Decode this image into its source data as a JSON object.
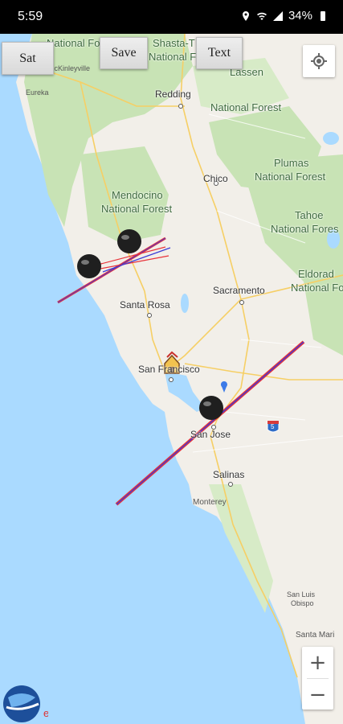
{
  "status_bar": {
    "time": "5:59",
    "battery": "34%"
  },
  "toolbar": {
    "sat_label": "Sat",
    "save_label": "Save",
    "text_label": "Text"
  },
  "map": {
    "labels": {
      "national_forest_top": "National Fore",
      "shasta": "Shasta-T",
      "shasta2": "National F",
      "mckinleyville": "McKinleyville",
      "eureka": "Eureka",
      "redding": "Redding",
      "lassen": "Lassen",
      "lassen2": "National Forest",
      "chico": "Chico",
      "plumas": "Plumas",
      "plumas2": "National Forest",
      "mendocino": "Mendocino",
      "mendocino2": "National Forest",
      "tahoe": "Tahoe",
      "tahoe2": "National Fores",
      "eldorado": "Eldorad",
      "eldorado2": "National Fore",
      "sacramento": "Sacramento",
      "santa_rosa": "Santa Rosa",
      "san_francisco": "San Francisco",
      "san_jose": "San Jose",
      "salinas": "Salinas",
      "monterey": "Monterey",
      "san_luis": "San Luis",
      "obispo": "Obispo",
      "santa_maria": "Santa Mari",
      "interstate": "5"
    }
  },
  "zoom": {
    "in_label": "+",
    "out_label": "−"
  },
  "colors": {
    "water": "#aadaff",
    "land": "#f2efe9",
    "forest": "#c8e3b5",
    "track_red": "#e8333a",
    "track_blue": "#3b3bd6"
  }
}
